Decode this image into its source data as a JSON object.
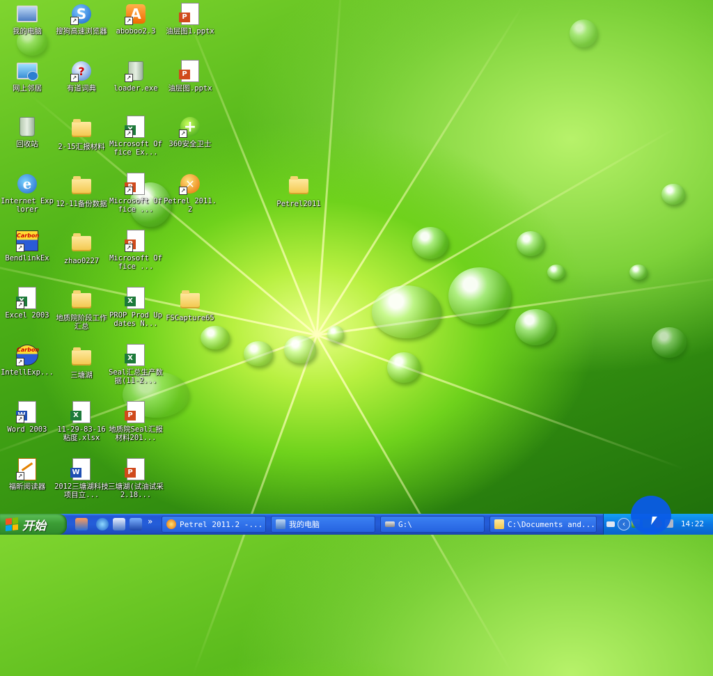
{
  "desktop": {
    "icons": [
      {
        "label": "我的电脑",
        "kind": "my-computer",
        "shortcut": false
      },
      {
        "label": "搜狗高速浏览器",
        "kind": "sogou-browser",
        "shortcut": true
      },
      {
        "label": "aboboo2.3",
        "kind": "aboboo",
        "shortcut": true
      },
      {
        "label": "油层图1.pptx",
        "kind": "pptx",
        "shortcut": false
      },
      {
        "label": "网上邻居",
        "kind": "network",
        "shortcut": false
      },
      {
        "label": "有道词典",
        "kind": "youdao",
        "shortcut": true
      },
      {
        "label": "loader.exe",
        "kind": "loader-bin",
        "shortcut": true
      },
      {
        "label": "油层图.pptx",
        "kind": "pptx",
        "shortcut": false
      },
      {
        "label": "回收站",
        "kind": "recycle-bin",
        "shortcut": false
      },
      {
        "label": "2-15汇报材料",
        "kind": "folder",
        "shortcut": false
      },
      {
        "label": "Microsoft Office Ex...",
        "kind": "excel",
        "shortcut": true
      },
      {
        "label": "360安全卫士",
        "kind": "360",
        "shortcut": true
      },
      {
        "label": "Internet Explorer",
        "kind": "ie",
        "shortcut": false
      },
      {
        "label": "12-11备份数据",
        "kind": "folder",
        "shortcut": false
      },
      {
        "label": "Microsoft Office ...",
        "kind": "powerpoint",
        "shortcut": true
      },
      {
        "label": "Petrel 2011.2",
        "kind": "petrel",
        "shortcut": true
      },
      {
        "label": "Petrel2011",
        "kind": "folder",
        "shortcut": false
      },
      {
        "label": "BendlinkEx",
        "kind": "carbon",
        "shortcut": true
      },
      {
        "label": "zhao0227",
        "kind": "folder",
        "shortcut": false
      },
      {
        "label": "Microsoft Office ...",
        "kind": "powerpoint",
        "shortcut": true
      },
      {
        "label": "Excel 2003",
        "kind": "excel",
        "shortcut": true
      },
      {
        "label": "地质院阶段工作汇总",
        "kind": "folder",
        "shortcut": false
      },
      {
        "label": "PROP Prod Updates N...",
        "kind": "xls",
        "shortcut": false
      },
      {
        "label": "FSCapture65",
        "kind": "folder",
        "shortcut": false
      },
      {
        "label": "IntellExp...",
        "kind": "carbon",
        "shortcut": true
      },
      {
        "label": "三塘湖",
        "kind": "folder",
        "shortcut": false
      },
      {
        "label": "Seal汇总生产数据(11-2...",
        "kind": "xls",
        "shortcut": false
      },
      {
        "label": "Word 2003",
        "kind": "word",
        "shortcut": true
      },
      {
        "label": "11-29-83-16 粘度.xlsx",
        "kind": "xls",
        "shortcut": false
      },
      {
        "label": "地质院Seal汇报材料201...",
        "kind": "pptx",
        "shortcut": false
      },
      {
        "label": "福昕阅读器",
        "kind": "foxit",
        "shortcut": true
      },
      {
        "label": "2012三塘湖科技项目立...",
        "kind": "doc",
        "shortcut": false
      },
      {
        "label": "三塘湖(试油试采2.18...",
        "kind": "pptx",
        "shortcut": false
      }
    ]
  },
  "taskbar": {
    "start_label": "开始",
    "quick_launch": [
      "show-desktop",
      "ie",
      "outlook",
      "media"
    ],
    "tasks": [
      {
        "label": "Petrel 2011.2 -...",
        "icon": "petrel",
        "active": false
      },
      {
        "label": "我的电脑",
        "icon": "my-computer",
        "active": false
      },
      {
        "label": "G:\\",
        "icon": "drive",
        "active": false
      },
      {
        "label": "C:\\Documents and...",
        "icon": "folder",
        "active": false
      }
    ],
    "tray": {
      "time": "14:22"
    }
  }
}
